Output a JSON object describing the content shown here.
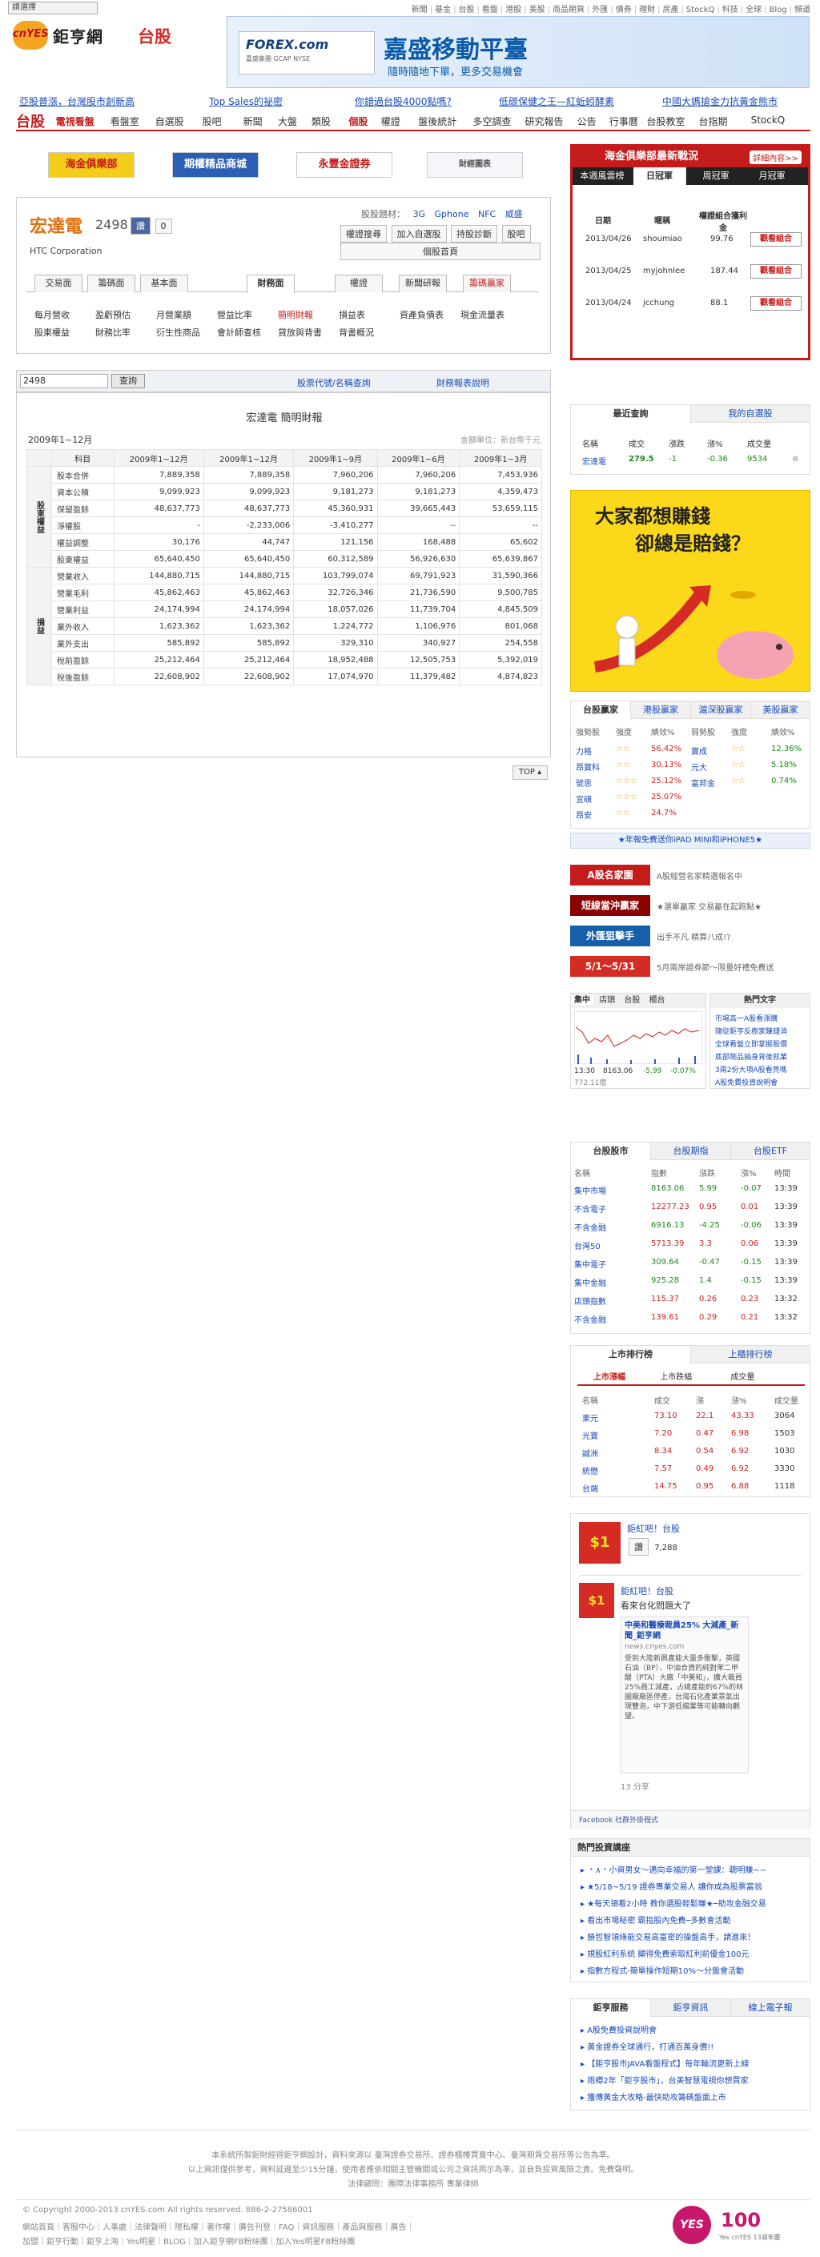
{
  "site": {
    "selector": "請選擇",
    "logo_mark": "cnYES",
    "logo_text": "鉅亨網",
    "section": "台股"
  },
  "topnav": [
    "新聞",
    "基金",
    "台股",
    "看盤",
    "港股",
    "美股",
    "商品期貨",
    "外匯",
    "債券",
    "理財",
    "房產",
    "StockQ",
    "科技",
    "全球",
    "Blog",
    "頻道"
  ],
  "banner": {
    "brand": "FOREX.com",
    "brand_sub": "嘉盛集團 GCAP NYSE",
    "headline": "嘉盛移動平臺",
    "subline": "隨時隨地下單，更多交易機會"
  },
  "headlinks": [
    "亞股普漲，台灣股市創新高",
    "Top Sales的祕密",
    "你錯過台股4000點嗎?",
    "低碳保健之王—紅蚯蚓酵素",
    "中國大媽搶金力抗黃金熊市"
  ],
  "tabs": [
    "台股",
    "電視看盤",
    "看盤室",
    "自選股",
    "股吧",
    "新聞",
    "大盤",
    "類股",
    "個股",
    "權證",
    "盤後統計",
    "多空調查",
    "研究報告",
    "公告",
    "行事曆",
    "台股教室",
    "台指期",
    "StockQ"
  ],
  "ads": [
    "海金俱樂部",
    "期權精品商城",
    "永豐金證券",
    "財經圖表"
  ],
  "stock": {
    "name": "宏達電",
    "code": "2498",
    "like": "讚",
    "count": "0",
    "eng": "HTC Corporation",
    "theme_label": "股股題材：",
    "themes": [
      "3G",
      "Gphone",
      "NFC",
      "威盛"
    ]
  },
  "stock_buttons": [
    "權證搜尋",
    "加入自選股",
    "持股診斷",
    "股吧",
    "個股首頁"
  ],
  "fintabs": [
    "交易面",
    "籌碼面",
    "基本面",
    "財務面",
    "權證",
    "新聞研報",
    "籌碼贏家"
  ],
  "sublinks": [
    [
      "每月營收",
      "盈虧預估",
      "月營業額",
      "營益比率",
      "簡明財報",
      "損益表",
      "資產負債表",
      "現金流量表"
    ],
    [
      "股東權益",
      "財務比率",
      "衍生性商品",
      "會計師查核",
      "貸放與背書",
      "背書概況"
    ]
  ],
  "search": {
    "value": "2498",
    "button": "查詢",
    "link1": "股票代號/名稱查詢",
    "link2": "財務報表說明"
  },
  "report": {
    "title": "宏達電 簡明財報",
    "period": "2009年1~12月",
    "unit": "金額單位：新台幣千元",
    "headers": [
      "科目",
      "2009年1~12月",
      "2009年1~12月",
      "2009年1~9月",
      "2009年1~6月",
      "2009年1~3月"
    ],
    "group1": "股東權益",
    "group2": "損益",
    "rows1": [
      [
        "股本合併",
        "7,889,358",
        "7,889,358",
        "7,960,206",
        "7,960,206",
        "7,453,936"
      ],
      [
        "資本公積",
        "9,099,923",
        "9,099,923",
        "9,181,273",
        "9,181,273",
        "4,359,473"
      ],
      [
        "保留盈餘",
        "48,637,773",
        "48,637,773",
        "45,360,931",
        "39,665,443",
        "53,659,115"
      ],
      [
        "淨權股",
        "-",
        "-2,233,006",
        "-3,410,277",
        "--",
        "--"
      ],
      [
        "權益調整",
        "30,176",
        "44,747",
        "121,156",
        "168,488",
        "65,602"
      ],
      [
        "股東權益",
        "65,640,450",
        "65,640,450",
        "60,312,589",
        "56,926,630",
        "65,639,867"
      ]
    ],
    "rows2": [
      [
        "營業收入",
        "144,880,715",
        "144,880,715",
        "103,799,074",
        "69,791,923",
        "31,590,366"
      ],
      [
        "營業毛利",
        "45,862,463",
        "45,862,463",
        "32,726,346",
        "21,736,590",
        "9,500,785"
      ],
      [
        "營業利益",
        "24,174,994",
        "24,174,994",
        "18,057,026",
        "11,739,704",
        "4,845,509"
      ],
      [
        "業外收入",
        "1,623,362",
        "1,623,362",
        "1,224,772",
        "1,106,976",
        "801,068"
      ],
      [
        "業外支出",
        "585,892",
        "585,892",
        "329,310",
        "340,927",
        "254,558"
      ],
      [
        "稅前盈餘",
        "25,212,464",
        "25,212,464",
        "18,952,488",
        "12,505,753",
        "5,392,019"
      ],
      [
        "稅後盈餘",
        "22,608,902",
        "22,608,902",
        "17,074,970",
        "11,379,482",
        "4,874,823"
      ]
    ]
  },
  "top_btn": "TOP",
  "club": {
    "title": "海金俱樂部最新戰況",
    "more": "詳細內容>>",
    "tabs": [
      "本週風雲榜",
      "日冠軍",
      "周冠軍",
      "月冠軍"
    ],
    "cols": [
      "日期",
      "暱稱",
      "權證組合獲利金"
    ],
    "btn": "觀看組合",
    "rows": [
      [
        "2013/04/26",
        "shoumiao",
        "99.76"
      ],
      [
        "2013/04/25",
        "myjohnlee",
        "187.44"
      ],
      [
        "2013/04/24",
        "jcchung",
        "88.1"
      ]
    ]
  },
  "watch": {
    "tabs": [
      "最近查詢",
      "我的自選股"
    ],
    "cols": [
      "名稱",
      "成交",
      "漲跌",
      "漲%",
      "成交量"
    ],
    "row": [
      "宏達電",
      "279.5",
      "-1",
      "-0.36",
      "9534"
    ]
  },
  "ad2": {
    "l1": "大家都想賺錢",
    "l2": "卻總是賠錢？"
  },
  "winners": {
    "tabs": [
      "台股贏家",
      "港股贏家",
      "滬深股贏家",
      "美股贏家"
    ],
    "cols": [
      "強勢股",
      "強度",
      "績效%",
      "弱勢股",
      "強度",
      "績效%"
    ],
    "rows": [
      [
        "力格",
        "☆☆",
        "56.42%",
        "寶成",
        "☆☆",
        "12.36%"
      ],
      [
        "昂寶科",
        "☆☆",
        "30.13%",
        "元大",
        "☆☆",
        "5.18%"
      ],
      [
        "號思",
        "☆☆☆",
        "25.12%",
        "富邦金",
        "☆☆",
        "0.74%"
      ],
      [
        "宜碩",
        "☆☆☆",
        "25.07%",
        "",
        "",
        ""
      ],
      [
        "昂安",
        "☆☆",
        "24.7%",
        "",
        "",
        ""
      ]
    ],
    "promo": "★年報免費送你iPAD MINI和iPHONE5★"
  },
  "promos": [
    {
      "label": "A股名家園",
      "text": "A股經營名家精選報名中",
      "color": "#c41b1b"
    },
    {
      "label": "短線當沖贏家",
      "text": "★選單贏家 交易贏在起跑點★",
      "color": "#8b0000"
    },
    {
      "label": "外匯狙擊手",
      "text": "出手不凡 精算八成!?",
      "color": "#1560a8"
    },
    {
      "label": "5/1～5/31",
      "text": "5月兩岸證券節～限量好禮免費送",
      "color": "#d42b24"
    }
  ],
  "minichart": {
    "tabs": [
      "集中",
      "店頭",
      "台股",
      "櫃台"
    ],
    "time": "13:30",
    "price": "8163.06",
    "chg": "-5.99",
    "pct": "-0.07%",
    "volume": "772.11億",
    "hot_title": "熱門文字",
    "hot": [
      "市場高一A股看漲購",
      "隨從鉅亨反樹家賺錢消",
      "全球看盤立即掌握股價",
      "底部剛品抽身背後就業",
      "3兩2份大項A股看亮嗎",
      "A股免費投資說明會"
    ]
  },
  "idx": {
    "tabs": [
      "台股股市",
      "台股期指",
      "台股ETF"
    ],
    "cols": [
      "名稱",
      "指數",
      "漲跌",
      "漲%",
      "時間"
    ],
    "rows": [
      [
        "集中市場",
        "8163.06",
        "5.99",
        "-0.07",
        "13:39"
      ],
      [
        "不含電子",
        "12277.23",
        "0.95",
        "0.01",
        "13:39"
      ],
      [
        "不含金融",
        "6916.13",
        "-4.25",
        "-0.06",
        "13:39"
      ],
      [
        "台灣50",
        "5713.39",
        "3.3",
        "0.06",
        "13:39"
      ],
      [
        "集中電子",
        "309.64",
        "-0.47",
        "-0.15",
        "13:39"
      ],
      [
        "集中金融",
        "925.28",
        "1.4",
        "-0.15",
        "13:39"
      ],
      [
        "店頭指數",
        "115.37",
        "0.26",
        "0.23",
        "13:32"
      ],
      [
        "不含金融",
        "139.61",
        "0.29",
        "0.21",
        "13:32"
      ]
    ]
  },
  "rank": {
    "tabs": [
      "上市排行榜",
      "上櫃排行榜"
    ],
    "sub": [
      "上市漲幅",
      "上市跌幅",
      "成交量"
    ],
    "cols": [
      "名稱",
      "成交",
      "漲",
      "漲%",
      "成交量"
    ],
    "rows": [
      [
        "東元",
        "73.10",
        "22.1",
        "43.33",
        "3064"
      ],
      [
        "光寶",
        "7.20",
        "0.47",
        "6.98",
        "1503"
      ],
      [
        "誠洲",
        "8.34",
        "0.54",
        "6.92",
        "1030"
      ],
      [
        "統懋",
        "7.57",
        "0.49",
        "6.92",
        "3330"
      ],
      [
        "台端",
        "14.75",
        "0.95",
        "6.88",
        "1118"
      ]
    ]
  },
  "fb": {
    "page": "鉅紅吧！台股",
    "likes": "7,288",
    "like": "讚",
    "post_author": "鉅紅吧！台股",
    "post_text": "看來台化問題大了",
    "link_title": "中美和醫療裁員25% 大減產_新聞_鉅亨網",
    "link_site": "news.cnyes.com",
    "link_desc": "受到大陸新興產能大量多衝擊，英國石油（BP）、中油合資的純對苯二甲酸（PTA）大廠「中美和」，擴大裁員25%員工減產，占總產能約67%的林園廠廠區停產，台灣石化產業景氣出現雙泡，中下游低檔業等可能轉向觀望。",
    "share": "13 分享",
    "footer": "Facebook 社群外掛程式"
  },
  "courses": {
    "title": "熱門投資講座",
    "items": [
      "﹡∧﹡小資男女～邁向幸福的第一堂課：聰明賺∼∼",
      "★5/18~5/19 證券專業交易人 讓你成為股票富翁",
      "★每天領看2小時 教你選股輕鬆賺★─助攻金融交易",
      "看出市場秘密 霸指股內免費─多數會活動",
      "勝哲智領綠能交易高富密的操盤高手，請進來！",
      "規股紅利系統 顯得免費索取紅利前優金100元",
      "指數方程式-簡單操作短期10%～分盤會活動"
    ]
  },
  "services": {
    "tabs": [
      "鉅亨服務",
      "鉅亨資訊",
      "線上電子報"
    ],
    "items": [
      "A股免費投資說明會",
      "黃金證券全球通行，打通百萬身價!!",
      "【鉅亨股市JAVA看盤程式】每年輪流更新上線",
      "雨樽2年「鉅亨股市」，台美智慧電視你想買家",
      "獲傳黃金大攻略-最快助攻籌碼盤面上市"
    ]
  },
  "footer": {
    "l1": "本系統所製鉅財經得鉅亨網設計，資料來源以 臺灣證券交易所、證券櫃檯買賣中心、臺灣期貨交易所等公告為準。",
    "l2": "以上資訊僅供參考，資料延遲至少15分鐘，使用者應依相關主管機關或公司之資訊揭示為準，並自負投資風險之責。免費聲明。",
    "l3": "法律顧問：團際法律事務所  專業律師",
    "copy": "© Copyright 2000-2013 cnYES.com All rights reserved.",
    "phone": "886-2-27586001",
    "nav1": "網站首頁｜客服中心｜人事處｜法律聲明｜隱私權｜著作權｜廣告刊登｜FAQ｜資訊服務｜產品與服務｜廣告｜",
    "nav2": "加盟｜鉅亨行動｜鉅亨上海｜Yes明星｜BLOG｜加入鉅亨網FB粉絲團｜加入Yes明星FB粉絲團",
    "anniv": "100",
    "anniv_sub": "Yes cnYES 13週年慶"
  }
}
